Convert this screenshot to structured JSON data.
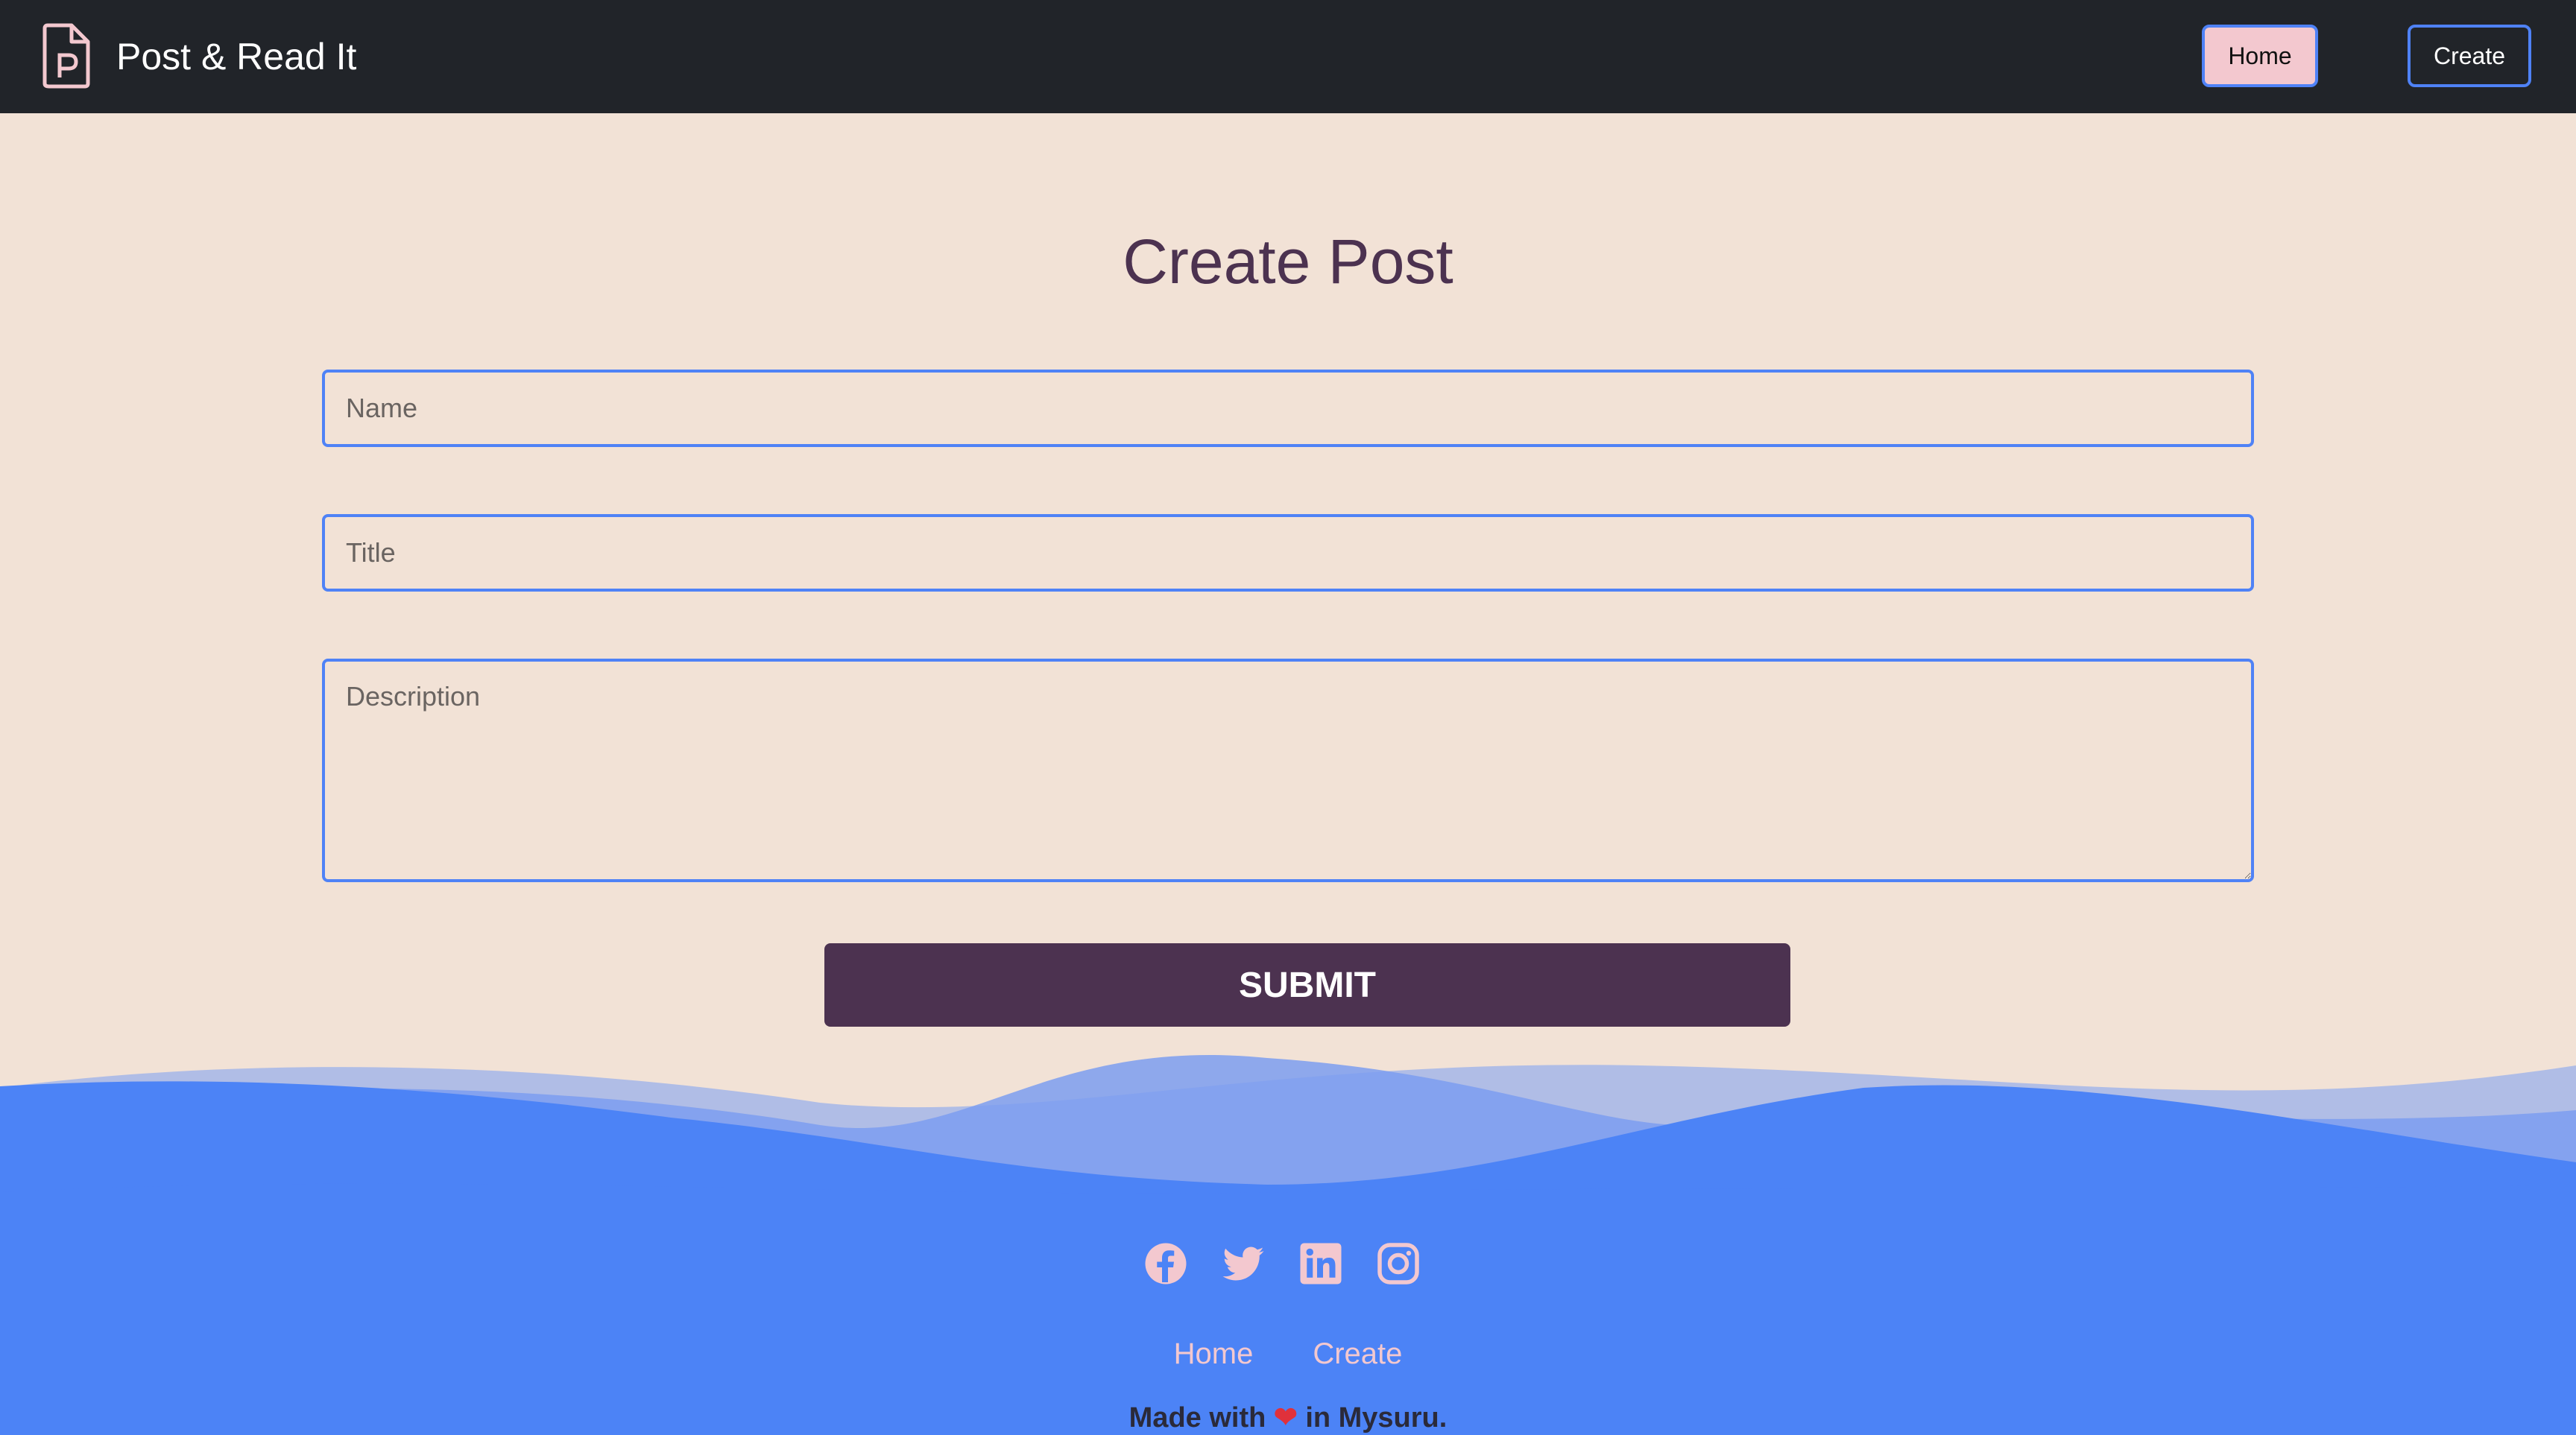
{
  "navbar": {
    "brand": "Post & Read It",
    "brand_icon": "post-document-icon",
    "home_label": "Home",
    "create_label": "Create"
  },
  "main": {
    "title": "Create Post",
    "name_placeholder": "Name",
    "title_placeholder": "Title",
    "description_placeholder": "Description",
    "submit_label": "SUBMIT"
  },
  "footer": {
    "social_icons": [
      "facebook-icon",
      "twitter-icon",
      "linkedin-icon",
      "instagram-icon"
    ],
    "links": {
      "home": "Home",
      "create": "Create"
    },
    "made_prefix": "Made with",
    "made_suffix": "in Mysuru."
  },
  "colors": {
    "navbar_bg": "#212429",
    "page_bg": "#f2e2d6",
    "accent_blue": "#4f82f6",
    "submit_bg": "#4c3250",
    "pink": "#f3c8cf"
  }
}
